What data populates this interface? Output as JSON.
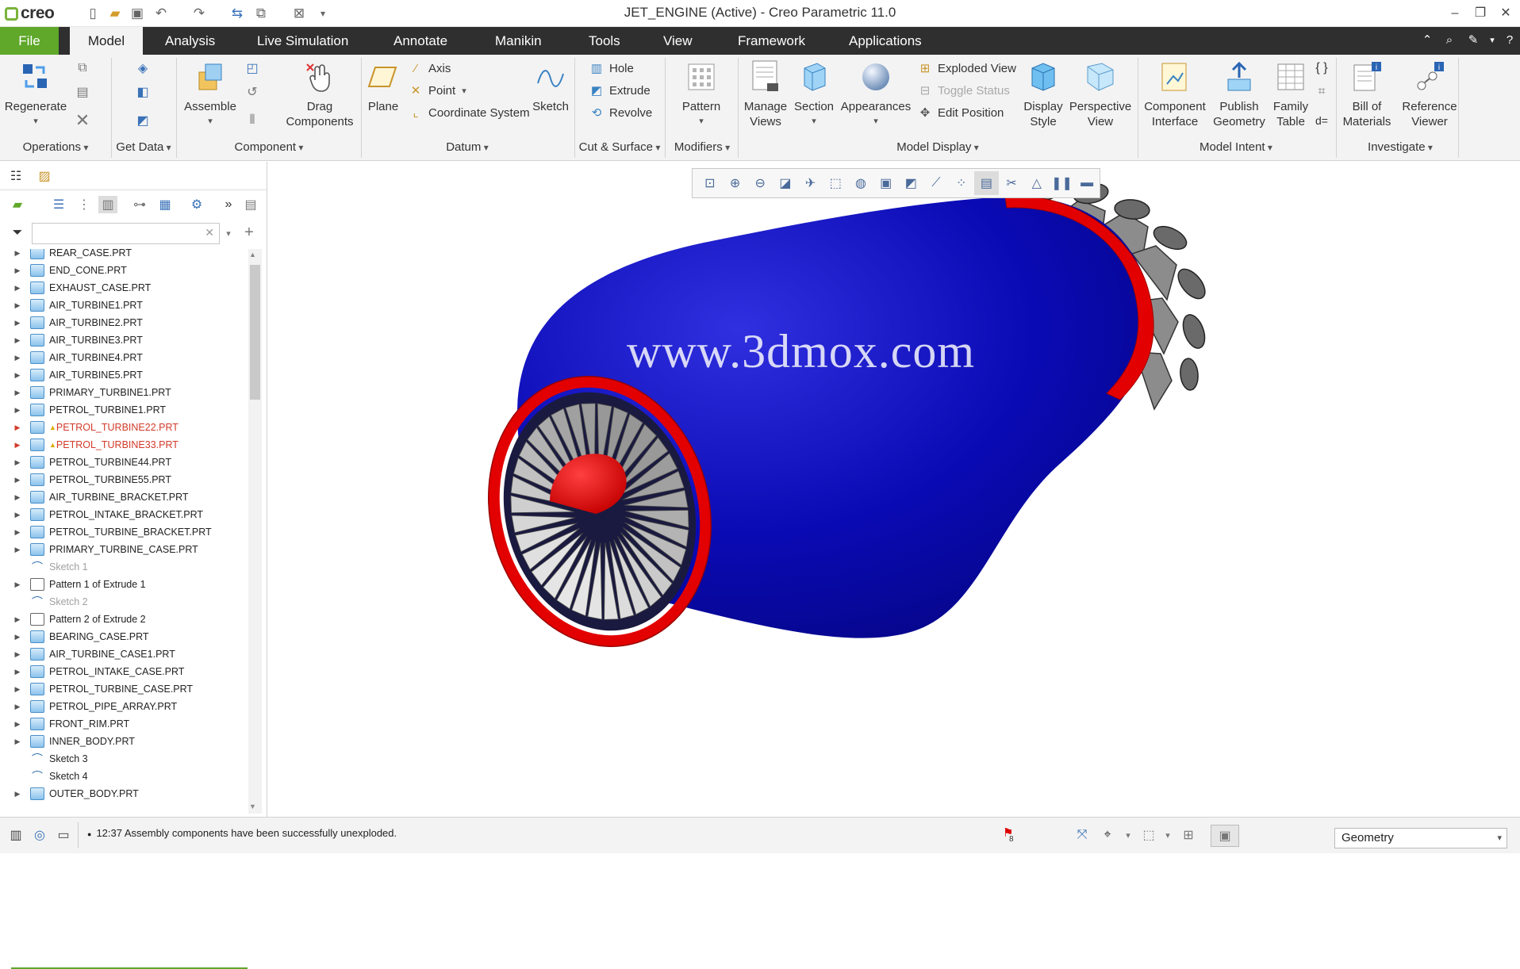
{
  "app": {
    "title": "JET_ENGINE (Active) - Creo Parametric 11.0",
    "logo_text": "creo"
  },
  "quick_access": [
    "new-icon",
    "open-icon",
    "save-icon",
    "undo-icon",
    "redo-icon",
    "regenerate-icon",
    "windows-icon",
    "close-window-icon",
    "customize-icon"
  ],
  "tabs": [
    "File",
    "Model",
    "Analysis",
    "Live Simulation",
    "Annotate",
    "Manikin",
    "Tools",
    "View",
    "Framework",
    "Applications"
  ],
  "ribbon": {
    "operations": {
      "label": "Operations",
      "regenerate": "Regenerate"
    },
    "get_data": {
      "label": "Get Data"
    },
    "component": {
      "label": "Component",
      "assemble": "Assemble",
      "drag": "Drag Components",
      "drag_l1": "Drag",
      "drag_l2": "Components"
    },
    "datum": {
      "label": "Datum",
      "plane": "Plane",
      "axis": "Axis",
      "point": "Point",
      "csys": "Coordinate System"
    },
    "sketch": "Sketch",
    "cut_surface": {
      "label": "Cut & Surface",
      "hole": "Hole",
      "extrude": "Extrude",
      "revolve": "Revolve"
    },
    "modifiers": {
      "label": "Modifiers",
      "pattern": "Pattern"
    },
    "model_display": {
      "label": "Model Display",
      "manage_views_l1": "Manage",
      "manage_views_l2": "Views",
      "section": "Section",
      "appearances": "Appearances",
      "exploded": "Exploded View",
      "toggle": "Toggle Status",
      "edit_pos": "Edit Position",
      "display_style_l1": "Display",
      "display_style_l2": "Style",
      "perspective_l1": "Perspective",
      "perspective_l2": "View"
    },
    "model_intent": {
      "label": "Model Intent",
      "component_interface_l1": "Component",
      "component_interface_l2": "Interface",
      "publish_l1": "Publish",
      "publish_l2": "Geometry",
      "family_l1": "Family",
      "family_l2": "Table"
    },
    "investigate": {
      "label": "Investigate",
      "bom_l1": "Bill of",
      "bom_l2": "Materials",
      "ref_l1": "Reference",
      "ref_l2": "Viewer"
    }
  },
  "tree": {
    "items": [
      {
        "label": "REAR_CASE.PRT",
        "kind": "part",
        "state": "normal"
      },
      {
        "label": "END_CONE.PRT",
        "kind": "part",
        "state": "normal"
      },
      {
        "label": "EXHAUST_CASE.PRT",
        "kind": "part",
        "state": "normal"
      },
      {
        "label": "AIR_TURBINE1.PRT",
        "kind": "part",
        "state": "normal"
      },
      {
        "label": "AIR_TURBINE2.PRT",
        "kind": "part",
        "state": "normal"
      },
      {
        "label": "AIR_TURBINE3.PRT",
        "kind": "part",
        "state": "normal"
      },
      {
        "label": "AIR_TURBINE4.PRT",
        "kind": "part",
        "state": "normal"
      },
      {
        "label": "AIR_TURBINE5.PRT",
        "kind": "part",
        "state": "normal"
      },
      {
        "label": "PRIMARY_TURBINE1.PRT",
        "kind": "part",
        "state": "normal"
      },
      {
        "label": "PETROL_TURBINE1.PRT",
        "kind": "part",
        "state": "normal"
      },
      {
        "label": "PETROL_TURBINE22.PRT",
        "kind": "part",
        "state": "warn"
      },
      {
        "label": "PETROL_TURBINE33.PRT",
        "kind": "part",
        "state": "warn"
      },
      {
        "label": "PETROL_TURBINE44.PRT",
        "kind": "part",
        "state": "normal"
      },
      {
        "label": "PETROL_TURBINE55.PRT",
        "kind": "part",
        "state": "normal"
      },
      {
        "label": "AIR_TURBINE_BRACKET.PRT",
        "kind": "part",
        "state": "normal"
      },
      {
        "label": "PETROL_INTAKE_BRACKET.PRT",
        "kind": "part",
        "state": "normal"
      },
      {
        "label": "PETROL_TURBINE_BRACKET.PRT",
        "kind": "part",
        "state": "normal"
      },
      {
        "label": "PRIMARY_TURBINE_CASE.PRT",
        "kind": "part",
        "state": "normal"
      },
      {
        "label": "Sketch 1",
        "kind": "sketch",
        "state": "dim"
      },
      {
        "label": "Pattern 1 of Extrude 1",
        "kind": "pattern",
        "state": "normal"
      },
      {
        "label": "Sketch 2",
        "kind": "sketch",
        "state": "dim"
      },
      {
        "label": "Pattern 2 of Extrude 2",
        "kind": "pattern",
        "state": "normal"
      },
      {
        "label": "BEARING_CASE.PRT",
        "kind": "part",
        "state": "normal"
      },
      {
        "label": "AIR_TURBINE_CASE1.PRT",
        "kind": "part",
        "state": "normal"
      },
      {
        "label": "PETROL_INTAKE_CASE.PRT",
        "kind": "part",
        "state": "normal"
      },
      {
        "label": "PETROL_TURBINE_CASE.PRT",
        "kind": "part",
        "state": "normal"
      },
      {
        "label": "PETROL_PIPE_ARRAY.PRT",
        "kind": "part",
        "state": "normal"
      },
      {
        "label": "FRONT_RIM.PRT",
        "kind": "part",
        "state": "normal"
      },
      {
        "label": "INNER_BODY.PRT",
        "kind": "part",
        "state": "normal"
      },
      {
        "label": "Sketch 3",
        "kind": "sketch",
        "state": "normal"
      },
      {
        "label": "Sketch 4",
        "kind": "sketch",
        "state": "normal"
      },
      {
        "label": "OUTER_BODY.PRT",
        "kind": "part",
        "state": "normal"
      }
    ]
  },
  "graphics": {
    "watermark": "www.3dmox.com",
    "colors": {
      "body": "#0a0ab4",
      "rim": "#e30000",
      "blades": "#c8c8c8"
    }
  },
  "status": {
    "message": "12:37 Assembly components have been successfully unexploded.",
    "flag_count": "8",
    "filter_value": "Geometry"
  }
}
